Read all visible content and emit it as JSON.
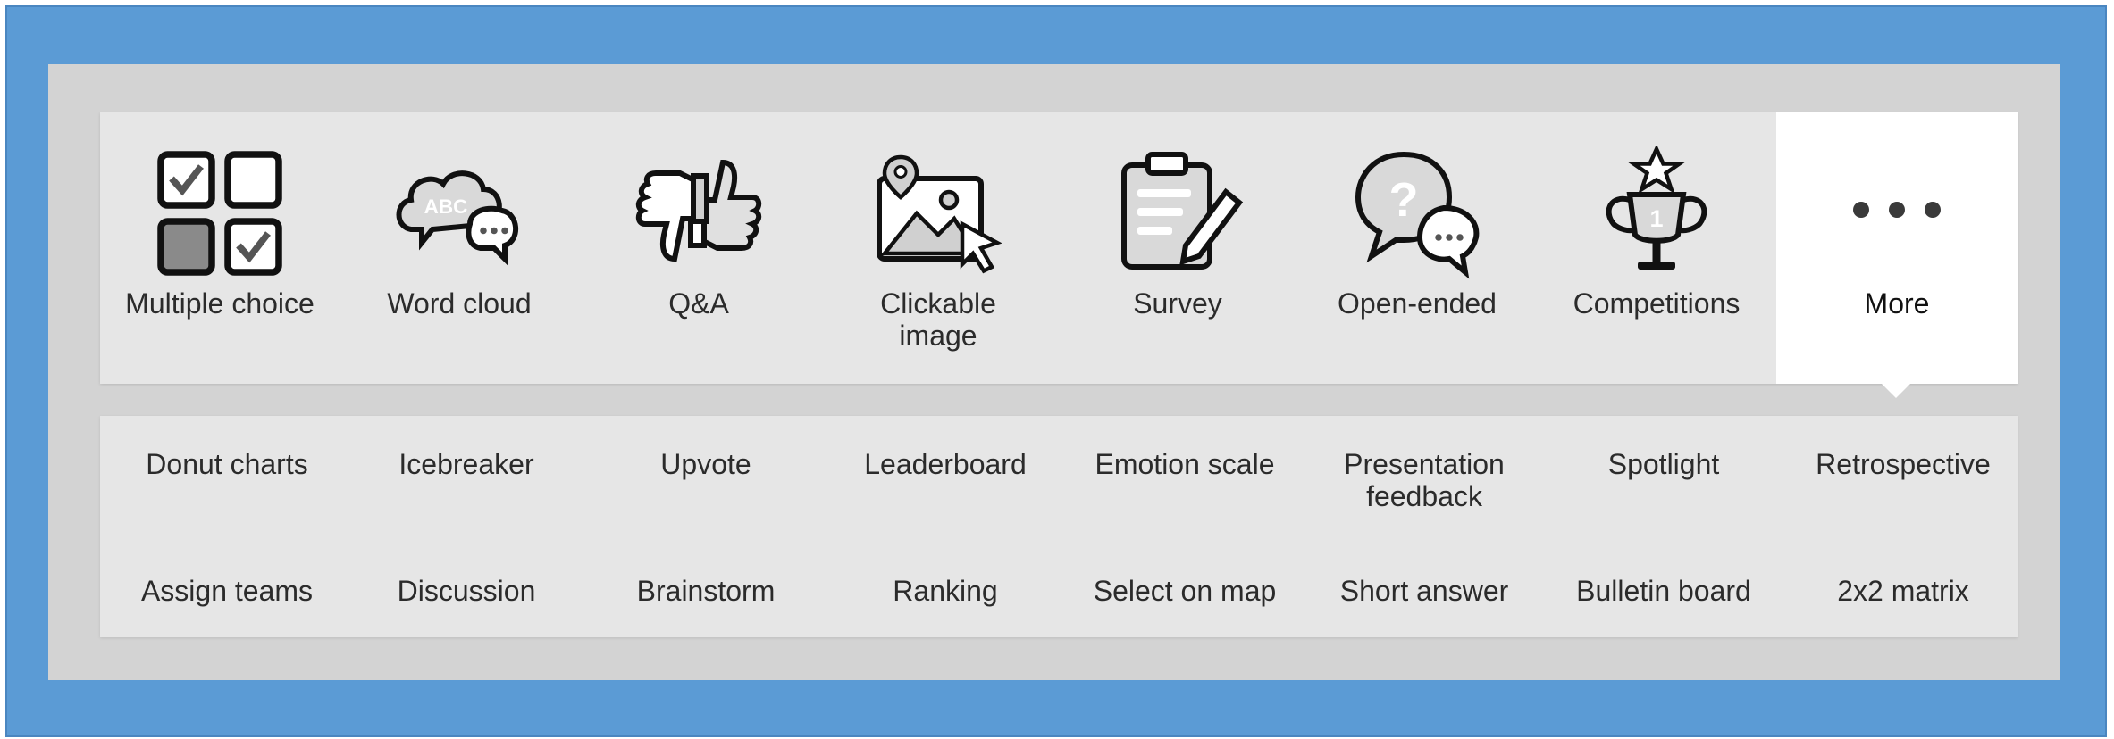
{
  "question_types": [
    {
      "label": "Multiple choice",
      "icon": "multiple-choice-grid-icon"
    },
    {
      "label": "Word cloud",
      "icon": "word-cloud-bubbles-icon",
      "icon_text": "ABC"
    },
    {
      "label": "Q&A",
      "icon": "thumbs-up-down-icon"
    },
    {
      "label": "Clickable image",
      "label_line1": "Clickable",
      "label_line2": "image",
      "icon": "image-pointer-icon"
    },
    {
      "label": "Survey",
      "icon": "clipboard-pencil-icon"
    },
    {
      "label": "Open-ended",
      "icon": "question-chat-bubbles-icon"
    },
    {
      "label": "Competitions",
      "icon": "trophy-icon",
      "icon_text": "1"
    },
    {
      "label": "More",
      "icon": "more-dots-icon",
      "active": true
    }
  ],
  "more_types": {
    "row1": [
      "Donut charts",
      "Icebreaker",
      "Upvote",
      "Leaderboard",
      "Emotion scale",
      "Presentation feedback",
      "Spotlight",
      "Retrospective"
    ],
    "row1_wrapped": {
      "line1": "Presentation",
      "line2": "feedback"
    },
    "row2": [
      "Assign teams",
      "Discussion",
      "Brainstorm",
      "Ranking",
      "Select on map",
      "Short answer",
      "Bulletin board",
      "2x2 matrix"
    ]
  },
  "colors": {
    "frame": "#5b9bd5",
    "panel": "#d3d3d3",
    "row": "#e6e6e6",
    "active_tab": "#ffffff",
    "text": "#2b2b2b"
  }
}
